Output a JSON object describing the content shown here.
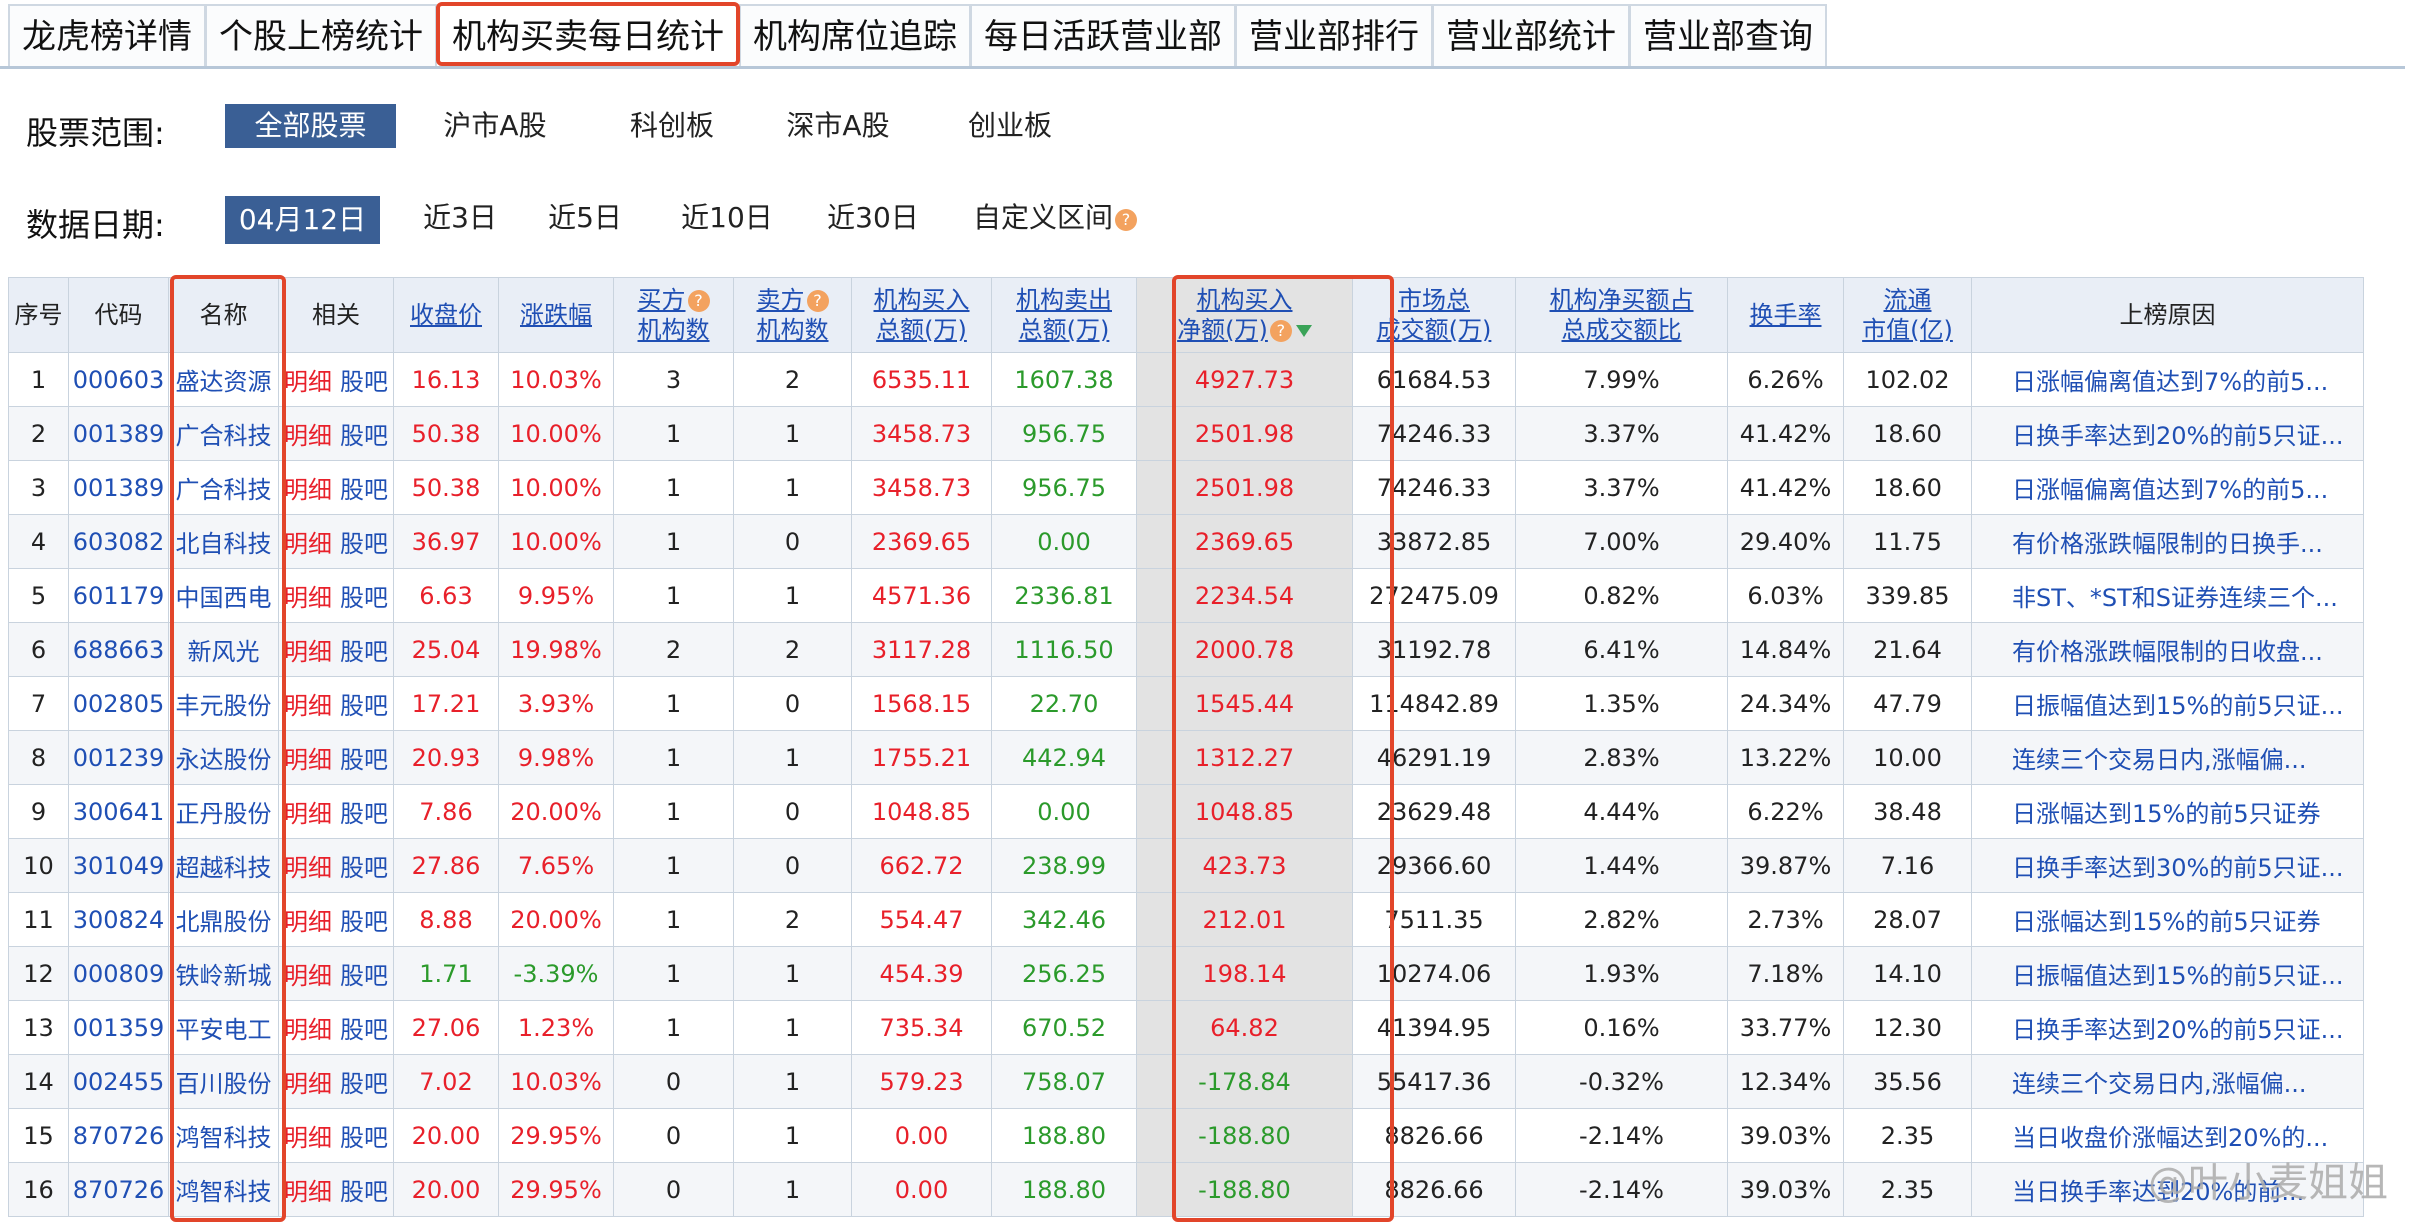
{
  "tabs": [
    {
      "label": "龙虎榜详情",
      "active": false
    },
    {
      "label": "个股上榜统计",
      "active": false
    },
    {
      "label": "机构买卖每日统计",
      "active": true
    },
    {
      "label": "机构席位追踪",
      "active": false
    },
    {
      "label": "每日活跃营业部",
      "active": false
    },
    {
      "label": "营业部排行",
      "active": false
    },
    {
      "label": "营业部统计",
      "active": false
    },
    {
      "label": "营业部查询",
      "active": false
    }
  ],
  "filters": {
    "scope_label": "股票范围:",
    "scope_options": [
      "全部股票",
      "沪市A股",
      "科创板",
      "深市A股",
      "创业板"
    ],
    "date_label": "数据日期:",
    "date_options": [
      "04月12日",
      "近3日",
      "近5日",
      "近10日",
      "近30日",
      "自定义区间"
    ],
    "help_glyph": "?"
  },
  "table": {
    "headers": {
      "seq": "序号",
      "code": "代码",
      "name": "名称",
      "related": "相关",
      "close": "收盘价",
      "change": "涨跌幅",
      "buy_inst_1": "买方",
      "buy_inst_2": "机构数",
      "sell_inst_1": "卖方",
      "sell_inst_2": "机构数",
      "buy_total_1": "机构买入",
      "buy_total_2": "总额(万)",
      "sell_total_1": "机构卖出",
      "sell_total_2": "总额(万)",
      "net_1": "机构买入",
      "net_2": "净额(万)",
      "market_1": "市场总",
      "market_2": "成交额(万)",
      "ratio_1": "机构净买额占",
      "ratio_2": "总成交额比",
      "turnover": "换手率",
      "cap_1": "流通",
      "cap_2": "市值(亿)",
      "reason": "上榜原因"
    },
    "related_detail": "明细",
    "related_forum": "股吧",
    "rows": [
      {
        "seq": "1",
        "code": "000603",
        "name": "盛达资源",
        "close": "16.13",
        "change": "10.03%",
        "buy_n": "3",
        "sell_n": "2",
        "buy_amt": "6535.11",
        "sell_amt": "1607.38",
        "net": "4927.73",
        "market": "61684.53",
        "ratio": "7.99%",
        "turnover": "6.26%",
        "cap": "102.02",
        "reason": "日涨幅偏离值达到7%的前5..."
      },
      {
        "seq": "2",
        "code": "001389",
        "name": "广合科技",
        "close": "50.38",
        "change": "10.00%",
        "buy_n": "1",
        "sell_n": "1",
        "buy_amt": "3458.73",
        "sell_amt": "956.75",
        "net": "2501.98",
        "market": "74246.33",
        "ratio": "3.37%",
        "turnover": "41.42%",
        "cap": "18.60",
        "reason": "日换手率达到20%的前5只证..."
      },
      {
        "seq": "3",
        "code": "001389",
        "name": "广合科技",
        "close": "50.38",
        "change": "10.00%",
        "buy_n": "1",
        "sell_n": "1",
        "buy_amt": "3458.73",
        "sell_amt": "956.75",
        "net": "2501.98",
        "market": "74246.33",
        "ratio": "3.37%",
        "turnover": "41.42%",
        "cap": "18.60",
        "reason": "日涨幅偏离值达到7%的前5..."
      },
      {
        "seq": "4",
        "code": "603082",
        "name": "北自科技",
        "close": "36.97",
        "change": "10.00%",
        "buy_n": "1",
        "sell_n": "0",
        "buy_amt": "2369.65",
        "sell_amt": "0.00",
        "net": "2369.65",
        "market": "33872.85",
        "ratio": "7.00%",
        "turnover": "29.40%",
        "cap": "11.75",
        "reason": "有价格涨跌幅限制的日换手..."
      },
      {
        "seq": "5",
        "code": "601179",
        "name": "中国西电",
        "close": "6.63",
        "change": "9.95%",
        "buy_n": "1",
        "sell_n": "1",
        "buy_amt": "4571.36",
        "sell_amt": "2336.81",
        "net": "2234.54",
        "market": "272475.09",
        "ratio": "0.82%",
        "turnover": "6.03%",
        "cap": "339.85",
        "reason": "非ST、*ST和S证券连续三个..."
      },
      {
        "seq": "6",
        "code": "688663",
        "name": "新风光",
        "close": "25.04",
        "change": "19.98%",
        "buy_n": "2",
        "sell_n": "2",
        "buy_amt": "3117.28",
        "sell_amt": "1116.50",
        "net": "2000.78",
        "market": "31192.78",
        "ratio": "6.41%",
        "turnover": "14.84%",
        "cap": "21.64",
        "reason": "有价格涨跌幅限制的日收盘..."
      },
      {
        "seq": "7",
        "code": "002805",
        "name": "丰元股份",
        "close": "17.21",
        "change": "3.93%",
        "buy_n": "1",
        "sell_n": "0",
        "buy_amt": "1568.15",
        "sell_amt": "22.70",
        "net": "1545.44",
        "market": "114842.89",
        "ratio": "1.35%",
        "turnover": "24.34%",
        "cap": "47.79",
        "reason": "日振幅值达到15%的前5只证..."
      },
      {
        "seq": "8",
        "code": "001239",
        "name": "永达股份",
        "close": "20.93",
        "change": "9.98%",
        "buy_n": "1",
        "sell_n": "1",
        "buy_amt": "1755.21",
        "sell_amt": "442.94",
        "net": "1312.27",
        "market": "46291.19",
        "ratio": "2.83%",
        "turnover": "13.22%",
        "cap": "10.00",
        "reason": "连续三个交易日内,涨幅偏..."
      },
      {
        "seq": "9",
        "code": "300641",
        "name": "正丹股份",
        "close": "7.86",
        "change": "20.00%",
        "buy_n": "1",
        "sell_n": "0",
        "buy_amt": "1048.85",
        "sell_amt": "0.00",
        "net": "1048.85",
        "market": "23629.48",
        "ratio": "4.44%",
        "turnover": "6.22%",
        "cap": "38.48",
        "reason": "日涨幅达到15%的前5只证券"
      },
      {
        "seq": "10",
        "code": "301049",
        "name": "超越科技",
        "close": "27.86",
        "change": "7.65%",
        "buy_n": "1",
        "sell_n": "0",
        "buy_amt": "662.72",
        "sell_amt": "238.99",
        "net": "423.73",
        "market": "29366.60",
        "ratio": "1.44%",
        "turnover": "39.87%",
        "cap": "7.16",
        "reason": "日换手率达到30%的前5只证..."
      },
      {
        "seq": "11",
        "code": "300824",
        "name": "北鼎股份",
        "close": "8.88",
        "change": "20.00%",
        "buy_n": "1",
        "sell_n": "2",
        "buy_amt": "554.47",
        "sell_amt": "342.46",
        "net": "212.01",
        "market": "7511.35",
        "ratio": "2.82%",
        "turnover": "2.73%",
        "cap": "28.07",
        "reason": "日涨幅达到15%的前5只证券"
      },
      {
        "seq": "12",
        "code": "000809",
        "name": "铁岭新城",
        "close": "1.71",
        "change": "-3.39%",
        "buy_n": "1",
        "sell_n": "1",
        "buy_amt": "454.39",
        "sell_amt": "256.25",
        "net": "198.14",
        "market": "10274.06",
        "ratio": "1.93%",
        "turnover": "7.18%",
        "cap": "14.10",
        "reason": "日振幅值达到15%的前5只证..."
      },
      {
        "seq": "13",
        "code": "001359",
        "name": "平安电工",
        "close": "27.06",
        "change": "1.23%",
        "buy_n": "1",
        "sell_n": "1",
        "buy_amt": "735.34",
        "sell_amt": "670.52",
        "net": "64.82",
        "market": "41394.95",
        "ratio": "0.16%",
        "turnover": "33.77%",
        "cap": "12.30",
        "reason": "日换手率达到20%的前5只证..."
      },
      {
        "seq": "14",
        "code": "002455",
        "name": "百川股份",
        "close": "7.02",
        "change": "10.03%",
        "buy_n": "0",
        "sell_n": "1",
        "buy_amt": "579.23",
        "sell_amt": "758.07",
        "net": "-178.84",
        "market": "55417.36",
        "ratio": "-0.32%",
        "turnover": "12.34%",
        "cap": "35.56",
        "reason": "连续三个交易日内,涨幅偏..."
      },
      {
        "seq": "15",
        "code": "870726",
        "name": "鸿智科技",
        "close": "20.00",
        "change": "29.95%",
        "buy_n": "0",
        "sell_n": "1",
        "buy_amt": "0.00",
        "sell_amt": "188.80",
        "net": "-188.80",
        "market": "8826.66",
        "ratio": "-2.14%",
        "turnover": "39.03%",
        "cap": "2.35",
        "reason": "当日收盘价涨幅达到20%的..."
      },
      {
        "seq": "16",
        "code": "870726",
        "name": "鸿智科技",
        "close": "20.00",
        "change": "29.95%",
        "buy_n": "0",
        "sell_n": "1",
        "buy_amt": "0.00",
        "sell_amt": "188.80",
        "net": "-188.80",
        "market": "8826.66",
        "ratio": "-2.14%",
        "turnover": "39.03%",
        "cap": "2.35",
        "reason": "当日换手率达到20%的前..."
      }
    ]
  },
  "watermark": "@叶小麦姐姐",
  "colors": {
    "up": "#e8202a",
    "down": "#2b9a2b",
    "link": "#1f4fb4",
    "highlight": "#e2452a",
    "selected": "#3a5f95"
  }
}
